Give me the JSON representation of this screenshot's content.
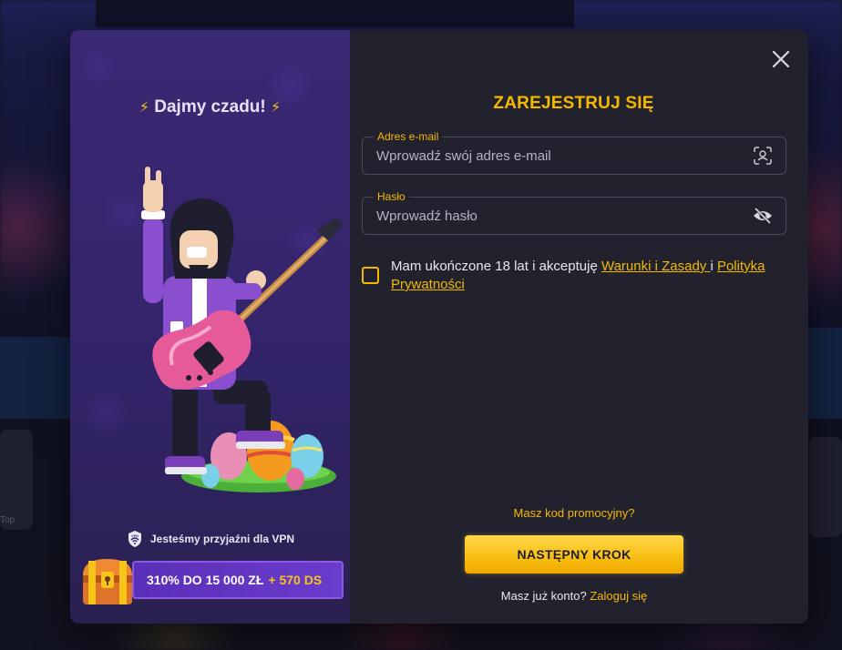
{
  "colors": {
    "accent": "#F5B800",
    "modal_bg": "#22222F",
    "left_panel_bg": "#3B2874",
    "bonus_bar": "#5A2FB8",
    "button": "#F8BD12"
  },
  "left_panel": {
    "tagline": "Dajmy czadu!",
    "vpn_text": "Jesteśmy przyjaźni dla VPN",
    "vpn_icon_label": "VPN",
    "bonus": {
      "main": "310% DO 15 000 ZŁ",
      "extra": "+ 570 DS"
    }
  },
  "form": {
    "title": "ZAREJESTRUJ SIĘ",
    "email": {
      "label": "Adres e-mail",
      "placeholder": "Wprowadź swój adres e-mail",
      "value": "",
      "icon": "face-scan-icon"
    },
    "password": {
      "label": "Hasło",
      "placeholder": "Wprowadź hasło",
      "value": "",
      "icon": "eye-slash-icon"
    },
    "consent": {
      "text_prefix": "Mam ukończone 18 lat i akceptuję ",
      "terms_link": "Warunki i Zasady ",
      "conjunction": "i ",
      "privacy_link": "Polityka Prywatności",
      "checked": false
    },
    "promo_link": "Masz kod promocyjny?",
    "next_button": "NASTĘPNY KROK",
    "login_prompt": "Masz już konto?",
    "login_link": "Zaloguj się"
  },
  "icons": {
    "close": "close-icon",
    "bolt": "lightning-bolt-icon",
    "shield": "vpn-shield-icon",
    "chest": "treasure-chest-icon"
  },
  "background": {
    "tile_text": "Top"
  }
}
